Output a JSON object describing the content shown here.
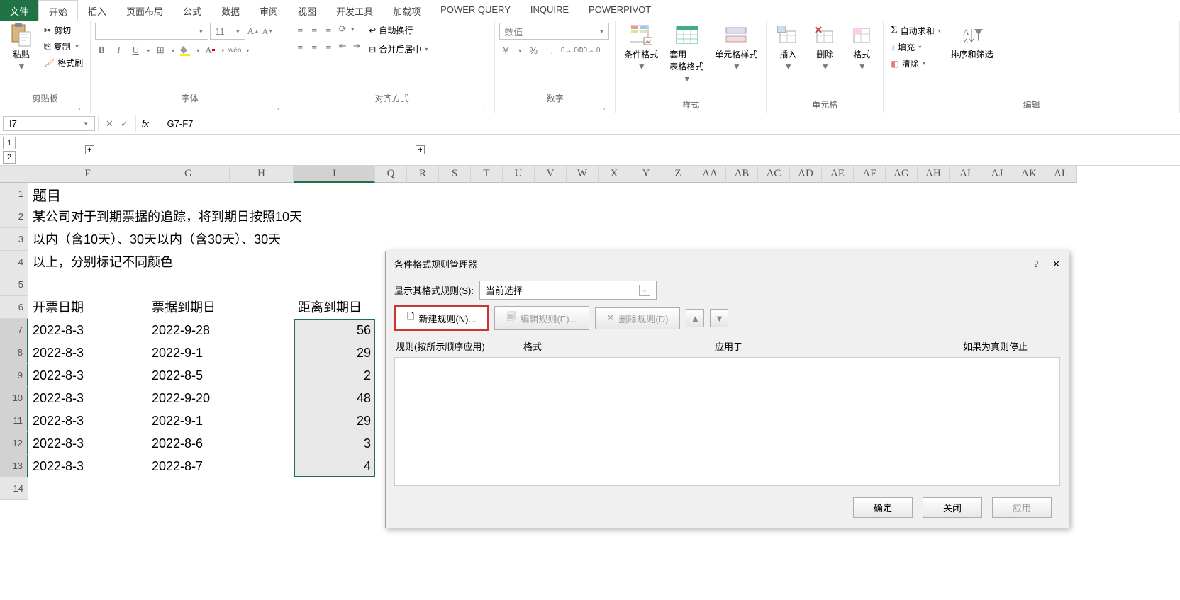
{
  "menu": {
    "file": "文件",
    "home": "开始",
    "insert": "插入",
    "pagelayout": "页面布局",
    "formulas": "公式",
    "data": "数据",
    "review": "审阅",
    "view": "视图",
    "developer": "开发工具",
    "addins": "加载项",
    "powerquery": "POWER QUERY",
    "inquire": "INQUIRE",
    "powerpivot": "POWERPIVOT"
  },
  "ribbon": {
    "clipboard": {
      "title": "剪贴板",
      "paste": "粘贴",
      "cut": "剪切",
      "copy": "复制",
      "format_painter": "格式刷"
    },
    "font": {
      "title": "字体",
      "size": "11",
      "wen": "wén"
    },
    "alignment": {
      "title": "对齐方式",
      "wrap": "自动换行",
      "merge": "合并后居中"
    },
    "number": {
      "title": "数字",
      "category": "数值"
    },
    "styles": {
      "title": "样式",
      "cf": "条件格式",
      "tfmt": "套用\n表格格式",
      "cstyle": "单元格样式"
    },
    "cells": {
      "title": "单元格",
      "insert": "插入",
      "delete": "删除",
      "format": "格式"
    },
    "editing": {
      "title": "编辑",
      "autosum": "自动求和",
      "fill": "填充",
      "clear": "清除",
      "sortfilter": "排序和筛选"
    }
  },
  "fbar": {
    "name": "I7",
    "formula": "=G7-F7"
  },
  "col_headers": [
    "F",
    "G",
    "H",
    "I",
    "Q",
    "R",
    "S",
    "T",
    "U",
    "V",
    "W",
    "X",
    "Y",
    "Z",
    "AA",
    "AB",
    "AC",
    "AD",
    "AE",
    "AF",
    "AG",
    "AH",
    "AI",
    "AJ",
    "AK",
    "AL"
  ],
  "rows": [
    1,
    2,
    3,
    4,
    5,
    6,
    7,
    8,
    9,
    10,
    11,
    12,
    13,
    14
  ],
  "sheet": {
    "title": "题目",
    "desc_l1": "某公司对于到期票据的追踪，将到期日按照10天",
    "desc_l2": "以内（含10天）、30天以内（含30天）、30天",
    "desc_l3": "以上，分别标记不同颜色",
    "h_issue": "开票日期",
    "h_due": "票据到期日",
    "h_days": "距离到期日",
    "data": [
      {
        "issue": "2022-8-3",
        "due": "2022-9-28",
        "days": "56"
      },
      {
        "issue": "2022-8-3",
        "due": "2022-9-1",
        "days": "29"
      },
      {
        "issue": "2022-8-3",
        "due": "2022-8-5",
        "days": "2"
      },
      {
        "issue": "2022-8-3",
        "due": "2022-9-20",
        "days": "48"
      },
      {
        "issue": "2022-8-3",
        "due": "2022-9-1",
        "days": "29"
      },
      {
        "issue": "2022-8-3",
        "due": "2022-8-6",
        "days": "3"
      },
      {
        "issue": "2022-8-3",
        "due": "2022-8-7",
        "days": "4"
      }
    ]
  },
  "dialog": {
    "title": "条件格式规则管理器",
    "show_rules": "显示其格式规则(S):",
    "scope": "当前选择",
    "new_rule": "新建规则(N)...",
    "edit_rule": "编辑规则(E)...",
    "delete_rule": "删除规则(D)",
    "col_rule": "规则(按所示顺序应用)",
    "col_format": "格式",
    "col_applies": "应用于",
    "col_stop": "如果为真则停止",
    "ok": "确定",
    "close": "关闭",
    "apply": "应用"
  }
}
